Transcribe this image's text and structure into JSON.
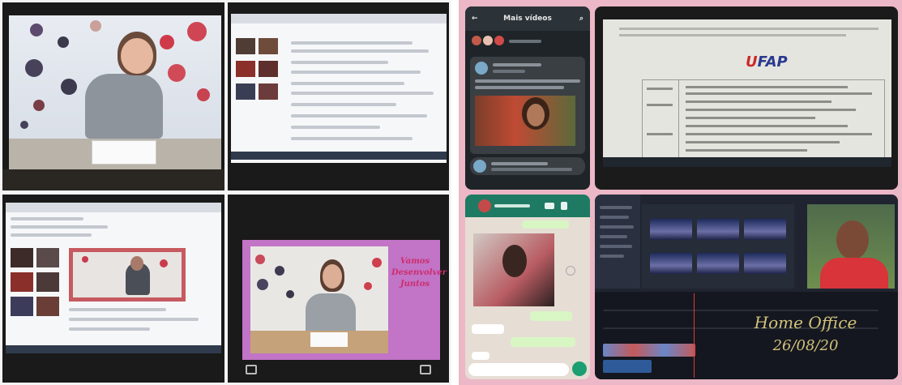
{
  "left_collage": {
    "frame_title_lines": [
      "Vamos",
      "Desenvolver",
      "Juntos"
    ]
  },
  "right_collage": {
    "messenger_header": "Mais vídeos",
    "document_logo_prefix": "U",
    "document_logo_suffix": "FAP",
    "video_caption_title": "Home Office",
    "video_caption_date": "26/08/20"
  },
  "colors": {
    "right_background": "#ecb7c6",
    "frame_pink": "#c274c6",
    "caption_gold": "#d2c27c",
    "whatsapp_green": "#1f7a63"
  }
}
